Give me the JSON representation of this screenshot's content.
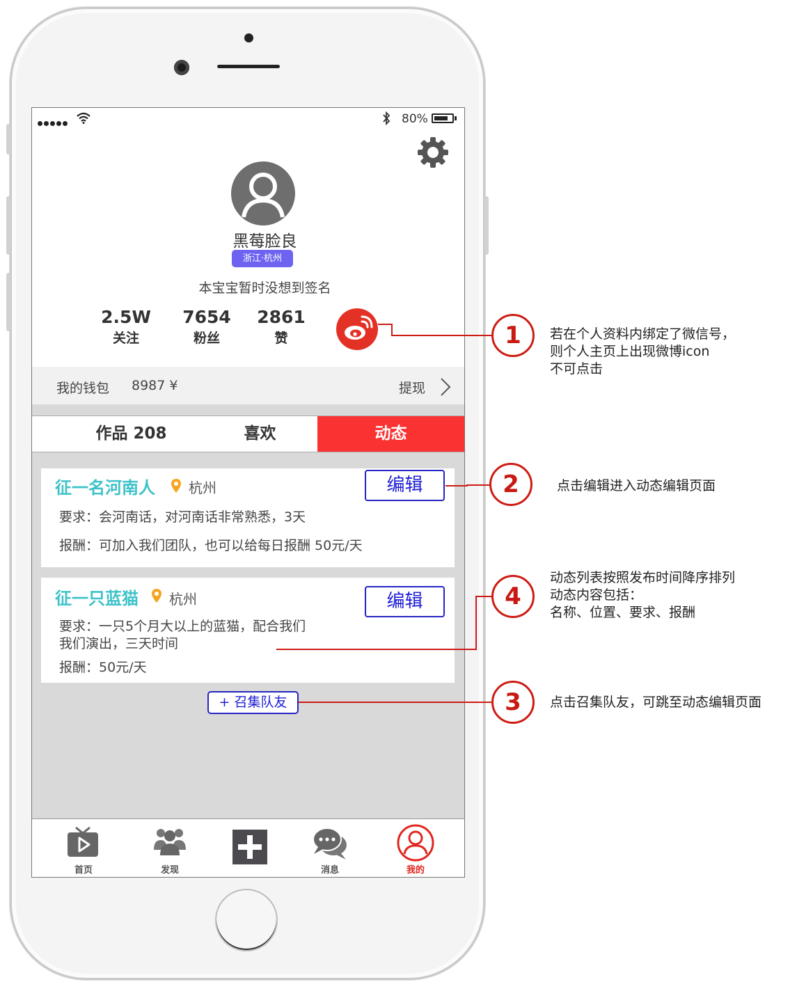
{
  "status_bar": {
    "battery": "80%",
    "battery_level": 0.8
  },
  "profile": {
    "username": "黑莓脸良",
    "location": "浙江·杭州",
    "signature": "本宝宝暂时没想到签名",
    "stats": [
      {
        "value": "2.5W",
        "label": "关注"
      },
      {
        "value": "7654",
        "label": "粉丝"
      },
      {
        "value": "2861",
        "label": "赞"
      }
    ]
  },
  "wallet": {
    "label": "我的钱包",
    "amount": "8987 ¥",
    "withdraw": "提现"
  },
  "tabs": [
    {
      "label": "作品 208"
    },
    {
      "label": "喜欢"
    },
    {
      "label": "动态"
    }
  ],
  "feed": [
    {
      "title": "征一名河南人",
      "city": "杭州",
      "requirement": "要求：会河南话，对河南话非常熟悉，3天",
      "reward": "报酬：可加入我们团队，也可以给每日报酬 50元/天",
      "edit_label": "编辑"
    },
    {
      "title": "征一只蓝猫",
      "city": "杭州",
      "requirement_lines": [
        "要求：一只5个月大以上的蓝猫，配合我们",
        "我们演出，三天时间"
      ],
      "reward": "报酬：50元/天",
      "edit_label": "编辑"
    }
  ],
  "recruit_button": "+ 召集队友",
  "bottom_nav": [
    {
      "label": "首页",
      "icon": "tv-play-icon"
    },
    {
      "label": "发现",
      "icon": "people-icon"
    },
    {
      "label": "",
      "icon": "plus-square-icon"
    },
    {
      "label": "消息",
      "icon": "chat-bubbles-icon"
    },
    {
      "label": "我的",
      "icon": "user-circle-icon"
    }
  ],
  "annotations": [
    {
      "number": "1",
      "lines": [
        "若在个人资料内绑定了微信号，",
        "则个人主页上出现微博icon",
        "不可点击"
      ]
    },
    {
      "number": "2",
      "lines": [
        "点击编辑进入动态编辑页面"
      ]
    },
    {
      "number": "4",
      "lines": [
        "动态列表按照发布时间降序排列",
        "动态内容包括：",
        "名称、位置、要求、报酬"
      ]
    },
    {
      "number": "3",
      "lines": [
        "点击召集队友，可跳至动态编辑页面"
      ]
    }
  ],
  "colors": {
    "accent_red": "#fb3232",
    "feed_title": "#3ec2c9",
    "edit_blue": "#1e1ed6",
    "badge_purple": "#6d63f0",
    "annotation_red": "#cc1c14"
  }
}
